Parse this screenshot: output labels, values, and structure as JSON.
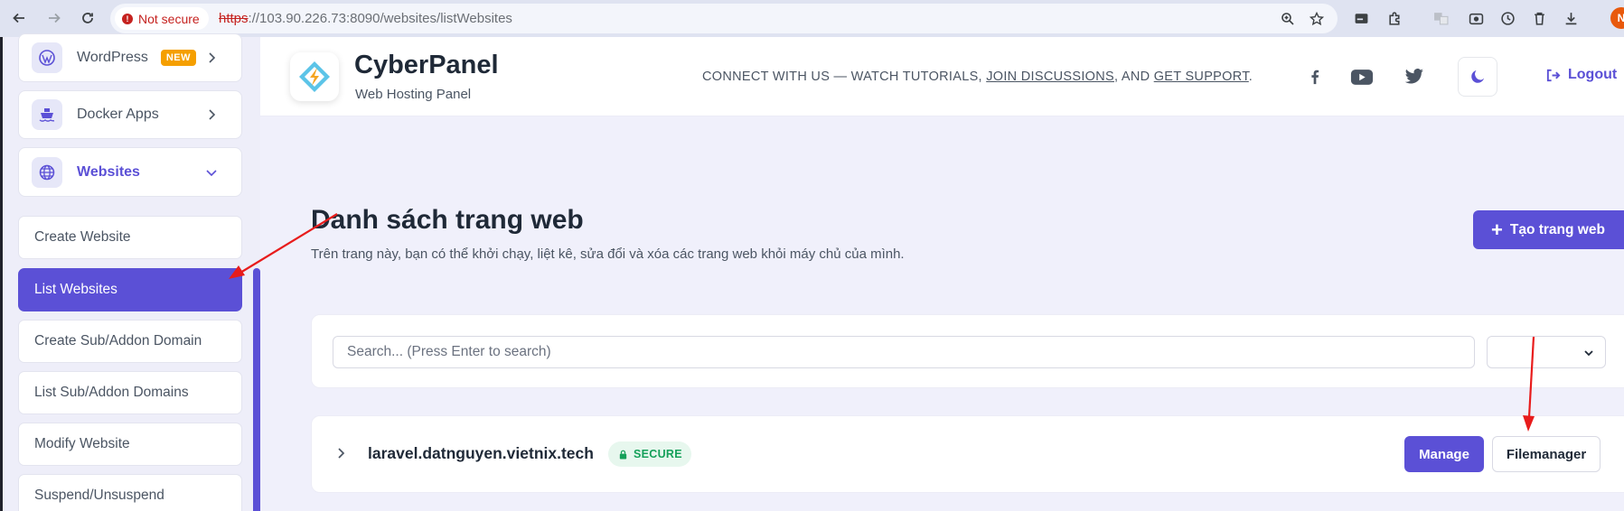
{
  "browser": {
    "security_chip": "Not secure",
    "url_scheme": "https",
    "url_rest": "://103.90.226.73:8090/websites/listWebsites",
    "profile_initial": "N",
    "nav_icons": [
      "back-icon",
      "forward-icon",
      "reload-icon"
    ],
    "toolbar_icons": [
      "zoom-icon",
      "bookmark-star-icon",
      "cast-icon",
      "extensions-icon",
      "translate-icon",
      "screenshot-icon",
      "history-icon",
      "trash-icon",
      "download-icon"
    ]
  },
  "sidebar": {
    "items": [
      {
        "label": "WordPress",
        "badge": "NEW",
        "icon": "wordpress-icon"
      },
      {
        "label": "Docker Apps",
        "icon": "ship-icon"
      },
      {
        "label": "Websites",
        "icon": "globe-icon",
        "expanded": true
      }
    ],
    "sub_items": [
      {
        "label": "Create Website"
      },
      {
        "label": "List Websites",
        "active": true
      },
      {
        "label": "Create Sub/Addon Domain"
      },
      {
        "label": "List Sub/Addon Domains"
      },
      {
        "label": "Modify Website"
      },
      {
        "label": "Suspend/Unsuspend"
      }
    ]
  },
  "header": {
    "brand": "CyberPanel",
    "tagline": "Web Hosting Panel",
    "connect_prefix": "CONNECT WITH US — WATCH TUTORIALS, ",
    "connect_link1": "JOIN DISCUSSIONS",
    "connect_mid": ", AND ",
    "connect_link2": "GET SUPPORT",
    "connect_suffix": ".",
    "social": [
      "facebook-icon",
      "youtube-icon",
      "twitter-icon"
    ],
    "logout_label": "Logout"
  },
  "main": {
    "title": "Danh sách trang web",
    "description": "Trên trang này, bạn có thể khởi chạy, liệt kê, sửa đổi và xóa các trang web khỏi máy chủ của mình.",
    "create_button": "Tạo trang web",
    "search_placeholder": "Search... (Press Enter to search)",
    "search_value": "",
    "select_value": "",
    "websites": [
      {
        "domain": "laravel.datnguyen.vietnix.tech",
        "status": "SECURE",
        "manage_label": "Manage",
        "filemanager_label": "Filemanager"
      }
    ]
  },
  "colors": {
    "accent": "#5b50d6",
    "secure": "#15a05a",
    "annotation_arrow": "#e81c1c",
    "badge_new": "#f59f00"
  }
}
